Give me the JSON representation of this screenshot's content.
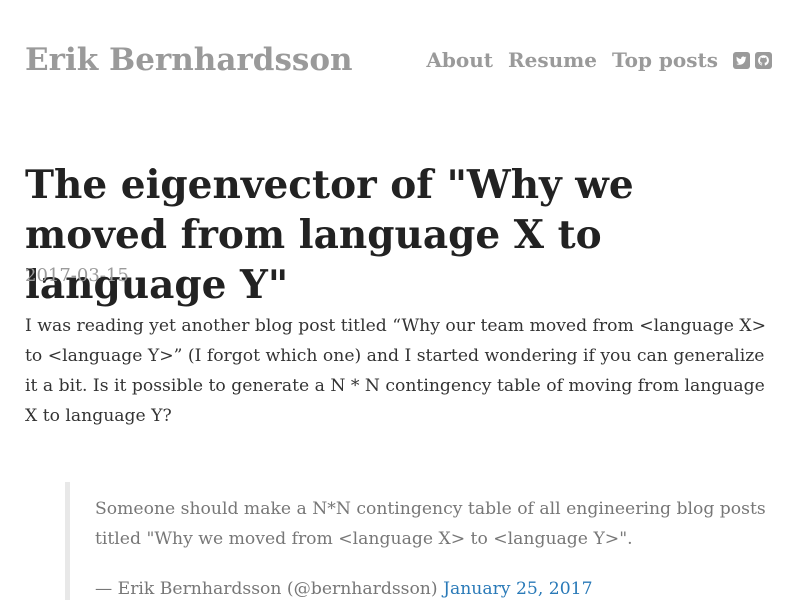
{
  "header": {
    "site_title": "Erik Bernhardsson",
    "nav": [
      {
        "label": "About"
      },
      {
        "label": "Resume"
      },
      {
        "label": "Top posts"
      }
    ],
    "social_icons": [
      "twitter-icon",
      "github-icon"
    ]
  },
  "post": {
    "title": "The eigenvector of \"Why we moved from language X to language Y\"",
    "date": "2017-03-15",
    "intro": "I was reading yet another blog post titled “Why our team moved from <language X> to <language Y>” (I forgot which one) and I started wondering if you can generalize it a bit. Is it possible to generate a N * N contingency table of moving from language X to language Y?"
  },
  "embedded_tweet": {
    "text": "Someone should make a N*N contingency table of all engineering blog posts titled \"Why we moved from <language X> to <language Y>\".",
    "attribution": "— Erik Bernhardsson (@bernhardsson)",
    "date_link": "January 25, 2017"
  },
  "colors": {
    "header_gray": "#9a9a9a",
    "title_dark": "#222222",
    "body_text": "#333333",
    "quote_text": "#777777",
    "link_blue": "#2a7ab8"
  }
}
